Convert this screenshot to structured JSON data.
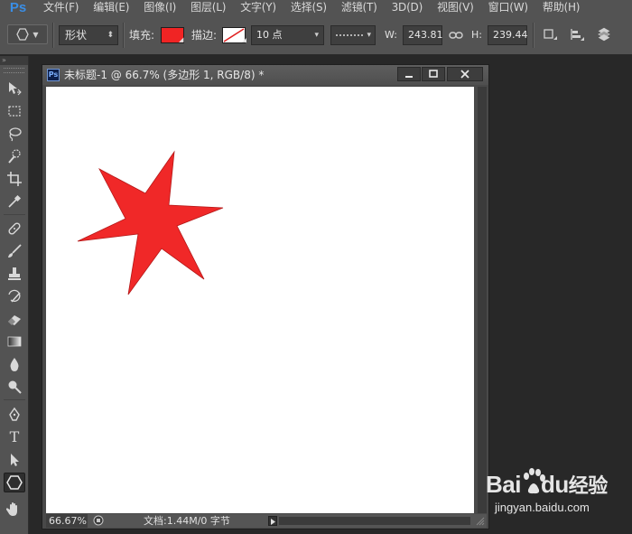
{
  "app": {
    "logo": "Ps",
    "menu": [
      "文件(F)",
      "编辑(E)",
      "图像(I)",
      "图层(L)",
      "文字(Y)",
      "选择(S)",
      "滤镜(T)",
      "3D(D)",
      "视图(V)",
      "窗口(W)",
      "帮助(H)"
    ]
  },
  "options": {
    "mode_value": "形状",
    "fill_label": "填充:",
    "fill_color": "#f02424",
    "stroke_label": "描边:",
    "stroke_width_value": "10 点",
    "width_label": "W:",
    "width_value": "243.81",
    "height_label": "H:",
    "height_value": "239.44"
  },
  "tools": {
    "items": [
      "move-tool",
      "marquee-tool",
      "lasso-tool",
      "quick-select-tool",
      "crop-tool",
      "eyedropper-tool",
      "healing-brush-tool",
      "brush-tool",
      "clone-stamp-tool",
      "history-brush-tool",
      "eraser-tool",
      "gradient-tool",
      "blur-tool",
      "dodge-tool",
      "pen-tool",
      "type-tool",
      "path-selection-tool",
      "polygon-tool",
      "hand-tool"
    ],
    "active": "polygon-tool"
  },
  "document": {
    "title": "未标题-1 @ 66.7% (多边形 1, RGB/8) *",
    "zoom": "66.67%",
    "doc_info": "文档:1.44M/0 字节",
    "shape": {
      "type": "star",
      "points": 6,
      "color": "#f02828"
    }
  },
  "watermark": {
    "brand": "Bai",
    "brand2": "du",
    "suffix": "经验",
    "url": "jingyan.baidu.com"
  }
}
